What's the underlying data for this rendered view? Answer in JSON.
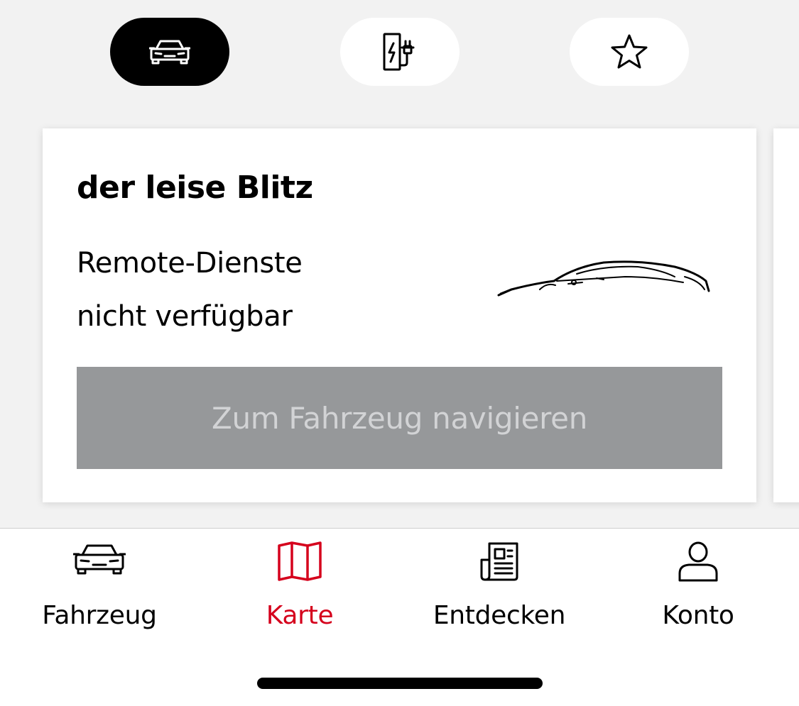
{
  "segments": [
    {
      "id": "vehicle",
      "icon": "car-icon",
      "active": true
    },
    {
      "id": "charging",
      "icon": "charging-station-icon",
      "active": false
    },
    {
      "id": "favorites",
      "icon": "star-icon",
      "active": false
    }
  ],
  "card": {
    "title": "der leise Blitz",
    "status_line1": "Remote-Dienste",
    "status_line2": "nicht verfügbar",
    "image": "car-silhouette",
    "button_label": "Zum Fahrzeug navigieren"
  },
  "tabs": [
    {
      "label": "Fahrzeug",
      "icon": "car-icon",
      "active": false
    },
    {
      "label": "Karte",
      "icon": "map-icon",
      "active": true
    },
    {
      "label": "Entdecken",
      "icon": "newspaper-icon",
      "active": false
    },
    {
      "label": "Konto",
      "icon": "user-icon",
      "active": false
    }
  ],
  "colors": {
    "accent": "#d5001c",
    "background": "#f2f2f2",
    "button_disabled_bg": "#96989a",
    "button_disabled_text": "#d2d3d5"
  }
}
